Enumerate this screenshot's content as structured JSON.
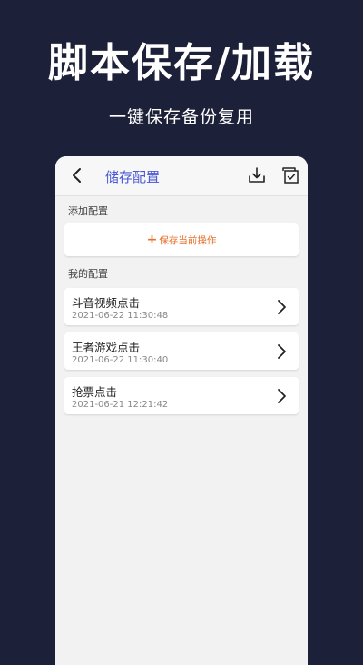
{
  "hero": {
    "title": "脚本保存/加载",
    "subtitle": "一键保存备份复用"
  },
  "appbar": {
    "back_icon": "back-arrow-icon",
    "title": "储存配置",
    "download_icon": "download-icon",
    "check_icon": "checklist-icon"
  },
  "sections": {
    "add_label": "添加配置",
    "my_label": "我的配置"
  },
  "add_button": {
    "icon": "plus-icon",
    "plus": "+",
    "label": "保存当前操作"
  },
  "configs": [
    {
      "name": "斗音视频点击",
      "time": "2021-06-22 11:30:48"
    },
    {
      "name": "王者游戏点击",
      "time": "2021-06-22 11:30:40"
    },
    {
      "name": "抢票点击",
      "time": "2021-06-21 12:21:42"
    }
  ],
  "colors": {
    "background": "#1c2038",
    "accent_title": "#4b59d6",
    "accent_action": "#e8702a",
    "panel": "#f2f2f2"
  }
}
